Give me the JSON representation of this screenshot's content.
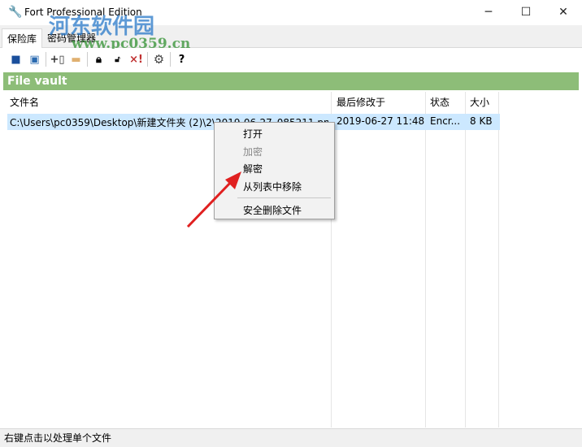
{
  "window": {
    "title": "Fort Professional Edition",
    "minimize": "─",
    "maximize": "☐",
    "close": "✕"
  },
  "tabs": [
    {
      "label": "保险库"
    },
    {
      "label": "密码管理器"
    }
  ],
  "toolbar": [
    "save-icon",
    "open-vault-icon",
    "add-file-icon",
    "folder-icon",
    "lock-icon",
    "unlock-icon",
    "remove-icon",
    "settings-icon",
    "help-icon"
  ],
  "toolbar_glyphs": {
    "help": "?",
    "remove": "×!"
  },
  "vault_title": "File vault",
  "columns": [
    "文件名",
    "最后修改于",
    "状态",
    "大小"
  ],
  "rows": [
    {
      "name": "C:\\Users\\pc0359\\Desktop\\新建文件夹 (2)\\2\\2019-06-27_085211.pn",
      "modified": "2019-06-27 11:48",
      "status": "Encr...",
      "size": "8 KB"
    }
  ],
  "context_menu": [
    {
      "label": "打开",
      "enabled": true
    },
    {
      "label": "加密",
      "enabled": false
    },
    {
      "label": "解密",
      "enabled": true
    },
    {
      "label": "从列表中移除",
      "enabled": true
    },
    {
      "label": "安全删除文件",
      "enabled": true
    }
  ],
  "status_bar": "右键点击以处理单个文件",
  "watermark": {
    "line1": "河东软件园",
    "line2": "www.pc0359.cn"
  },
  "colors": {
    "vault_header": "#8dbd78",
    "selection": "#cce8ff",
    "arrow": "#e02020"
  }
}
